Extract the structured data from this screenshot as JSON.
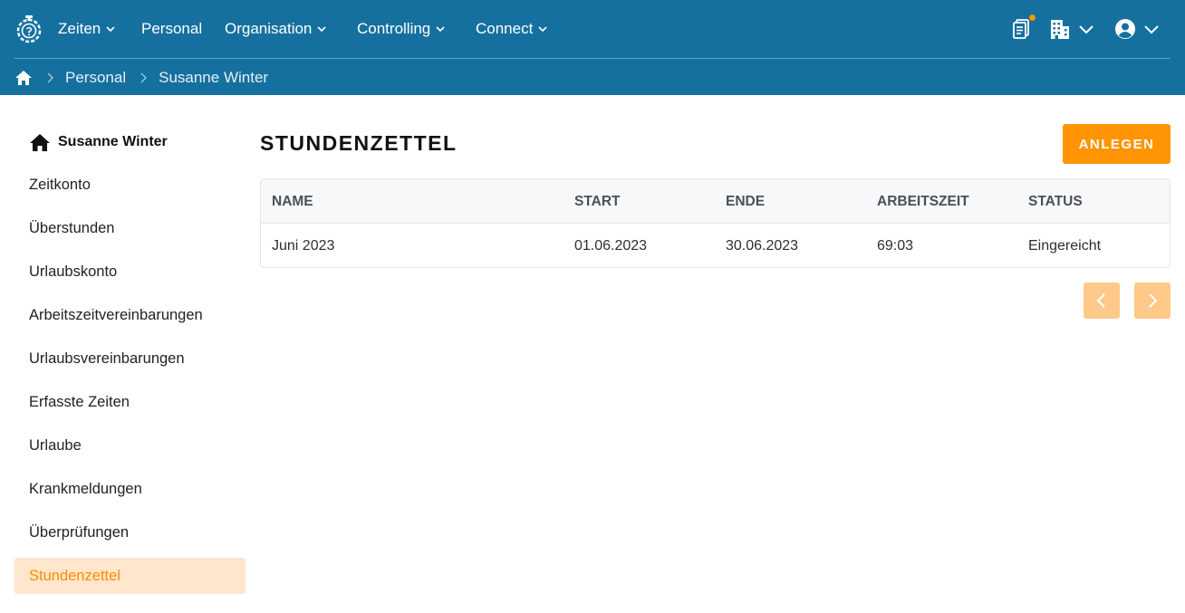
{
  "header": {
    "nav": [
      {
        "label": "Zeiten",
        "has_dropdown": true
      },
      {
        "label": "Personal",
        "has_dropdown": false
      },
      {
        "label": "Organisation",
        "has_dropdown": true
      },
      {
        "label": "Controlling",
        "has_dropdown": true
      },
      {
        "label": "Connect",
        "has_dropdown": true
      }
    ],
    "icons": [
      "logo-stopwatch-icon",
      "clipboard-icon",
      "building-icon",
      "user-circle-icon"
    ],
    "accent_color": "#16709f"
  },
  "breadcrumb": {
    "items": [
      "Personal",
      "Susanne Winter"
    ]
  },
  "sidebar": {
    "title": "Susanne Winter",
    "items": [
      {
        "label": "Zeitkonto"
      },
      {
        "label": "Überstunden"
      },
      {
        "label": "Urlaubskonto"
      },
      {
        "label": "Arbeitszeitvereinbarungen"
      },
      {
        "label": "Urlaubsvereinbarungen"
      },
      {
        "label": "Erfasste Zeiten"
      },
      {
        "label": "Urlaube"
      },
      {
        "label": "Krankmeldungen"
      },
      {
        "label": "Überprüfungen"
      },
      {
        "label": "Stundenzettel"
      }
    ],
    "active_item": "Stundenzettel"
  },
  "main": {
    "title": "STUNDENZETTEL",
    "create_button": "ANLEGEN",
    "button_color": "#ff9505",
    "table": {
      "columns": [
        "NAME",
        "START",
        "ENDE",
        "ARBEITSZEIT",
        "STATUS"
      ],
      "rows": [
        [
          "Juni 2023",
          "01.06.2023",
          "30.06.2023",
          "69:03",
          "Eingereicht"
        ]
      ]
    }
  }
}
